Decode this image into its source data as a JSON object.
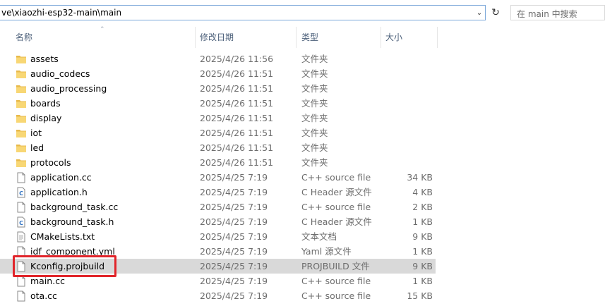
{
  "address": {
    "path": "ve\\xiaozhi-esp32-main\\main",
    "search_placeholder": "在 main 中搜索"
  },
  "columns": {
    "name": "名称",
    "date": "修改日期",
    "type": "类型",
    "size": "大小"
  },
  "files": [
    {
      "name": "assets",
      "date": "2025/4/26 11:56",
      "type": "文件夹",
      "size": "",
      "icon": "folder-icon"
    },
    {
      "name": "audio_codecs",
      "date": "2025/4/26 11:51",
      "type": "文件夹",
      "size": "",
      "icon": "folder-icon"
    },
    {
      "name": "audio_processing",
      "date": "2025/4/26 11:51",
      "type": "文件夹",
      "size": "",
      "icon": "folder-icon"
    },
    {
      "name": "boards",
      "date": "2025/4/26 11:51",
      "type": "文件夹",
      "size": "",
      "icon": "folder-icon"
    },
    {
      "name": "display",
      "date": "2025/4/26 11:51",
      "type": "文件夹",
      "size": "",
      "icon": "folder-icon"
    },
    {
      "name": "iot",
      "date": "2025/4/26 11:51",
      "type": "文件夹",
      "size": "",
      "icon": "folder-icon"
    },
    {
      "name": "led",
      "date": "2025/4/26 11:51",
      "type": "文件夹",
      "size": "",
      "icon": "folder-icon"
    },
    {
      "name": "protocols",
      "date": "2025/4/26 11:51",
      "type": "文件夹",
      "size": "",
      "icon": "folder-icon"
    },
    {
      "name": "application.cc",
      "date": "2025/4/25 7:19",
      "type": "C++ source file",
      "size": "34 KB",
      "icon": "file-icon"
    },
    {
      "name": "application.h",
      "date": "2025/4/25 7:19",
      "type": "C Header 源文件",
      "size": "4 KB",
      "icon": "c-header-icon"
    },
    {
      "name": "background_task.cc",
      "date": "2025/4/25 7:19",
      "type": "C++ source file",
      "size": "2 KB",
      "icon": "file-icon"
    },
    {
      "name": "background_task.h",
      "date": "2025/4/25 7:19",
      "type": "C Header 源文件",
      "size": "1 KB",
      "icon": "c-header-icon"
    },
    {
      "name": "CMakeLists.txt",
      "date": "2025/4/25 7:19",
      "type": "文本文档",
      "size": "9 KB",
      "icon": "text-file-icon"
    },
    {
      "name": "idf_component.yml",
      "date": "2025/4/25 7:19",
      "type": "Yaml 源文件",
      "size": "1 KB",
      "icon": "file-icon"
    },
    {
      "name": "Kconfig.projbuild",
      "date": "2025/4/25 7:19",
      "type": "PROJBUILD 文件",
      "size": "9 KB",
      "icon": "file-icon",
      "selected": true
    },
    {
      "name": "main.cc",
      "date": "2025/4/25 7:19",
      "type": "C++ source file",
      "size": "1 KB",
      "icon": "file-icon"
    },
    {
      "name": "ota.cc",
      "date": "2025/4/25 7:19",
      "type": "C++ source file",
      "size": "15 KB",
      "icon": "file-icon"
    }
  ],
  "colors": {
    "folder": "#f8d775",
    "selection": "#d9d9d9",
    "highlight": "#e1252b"
  }
}
